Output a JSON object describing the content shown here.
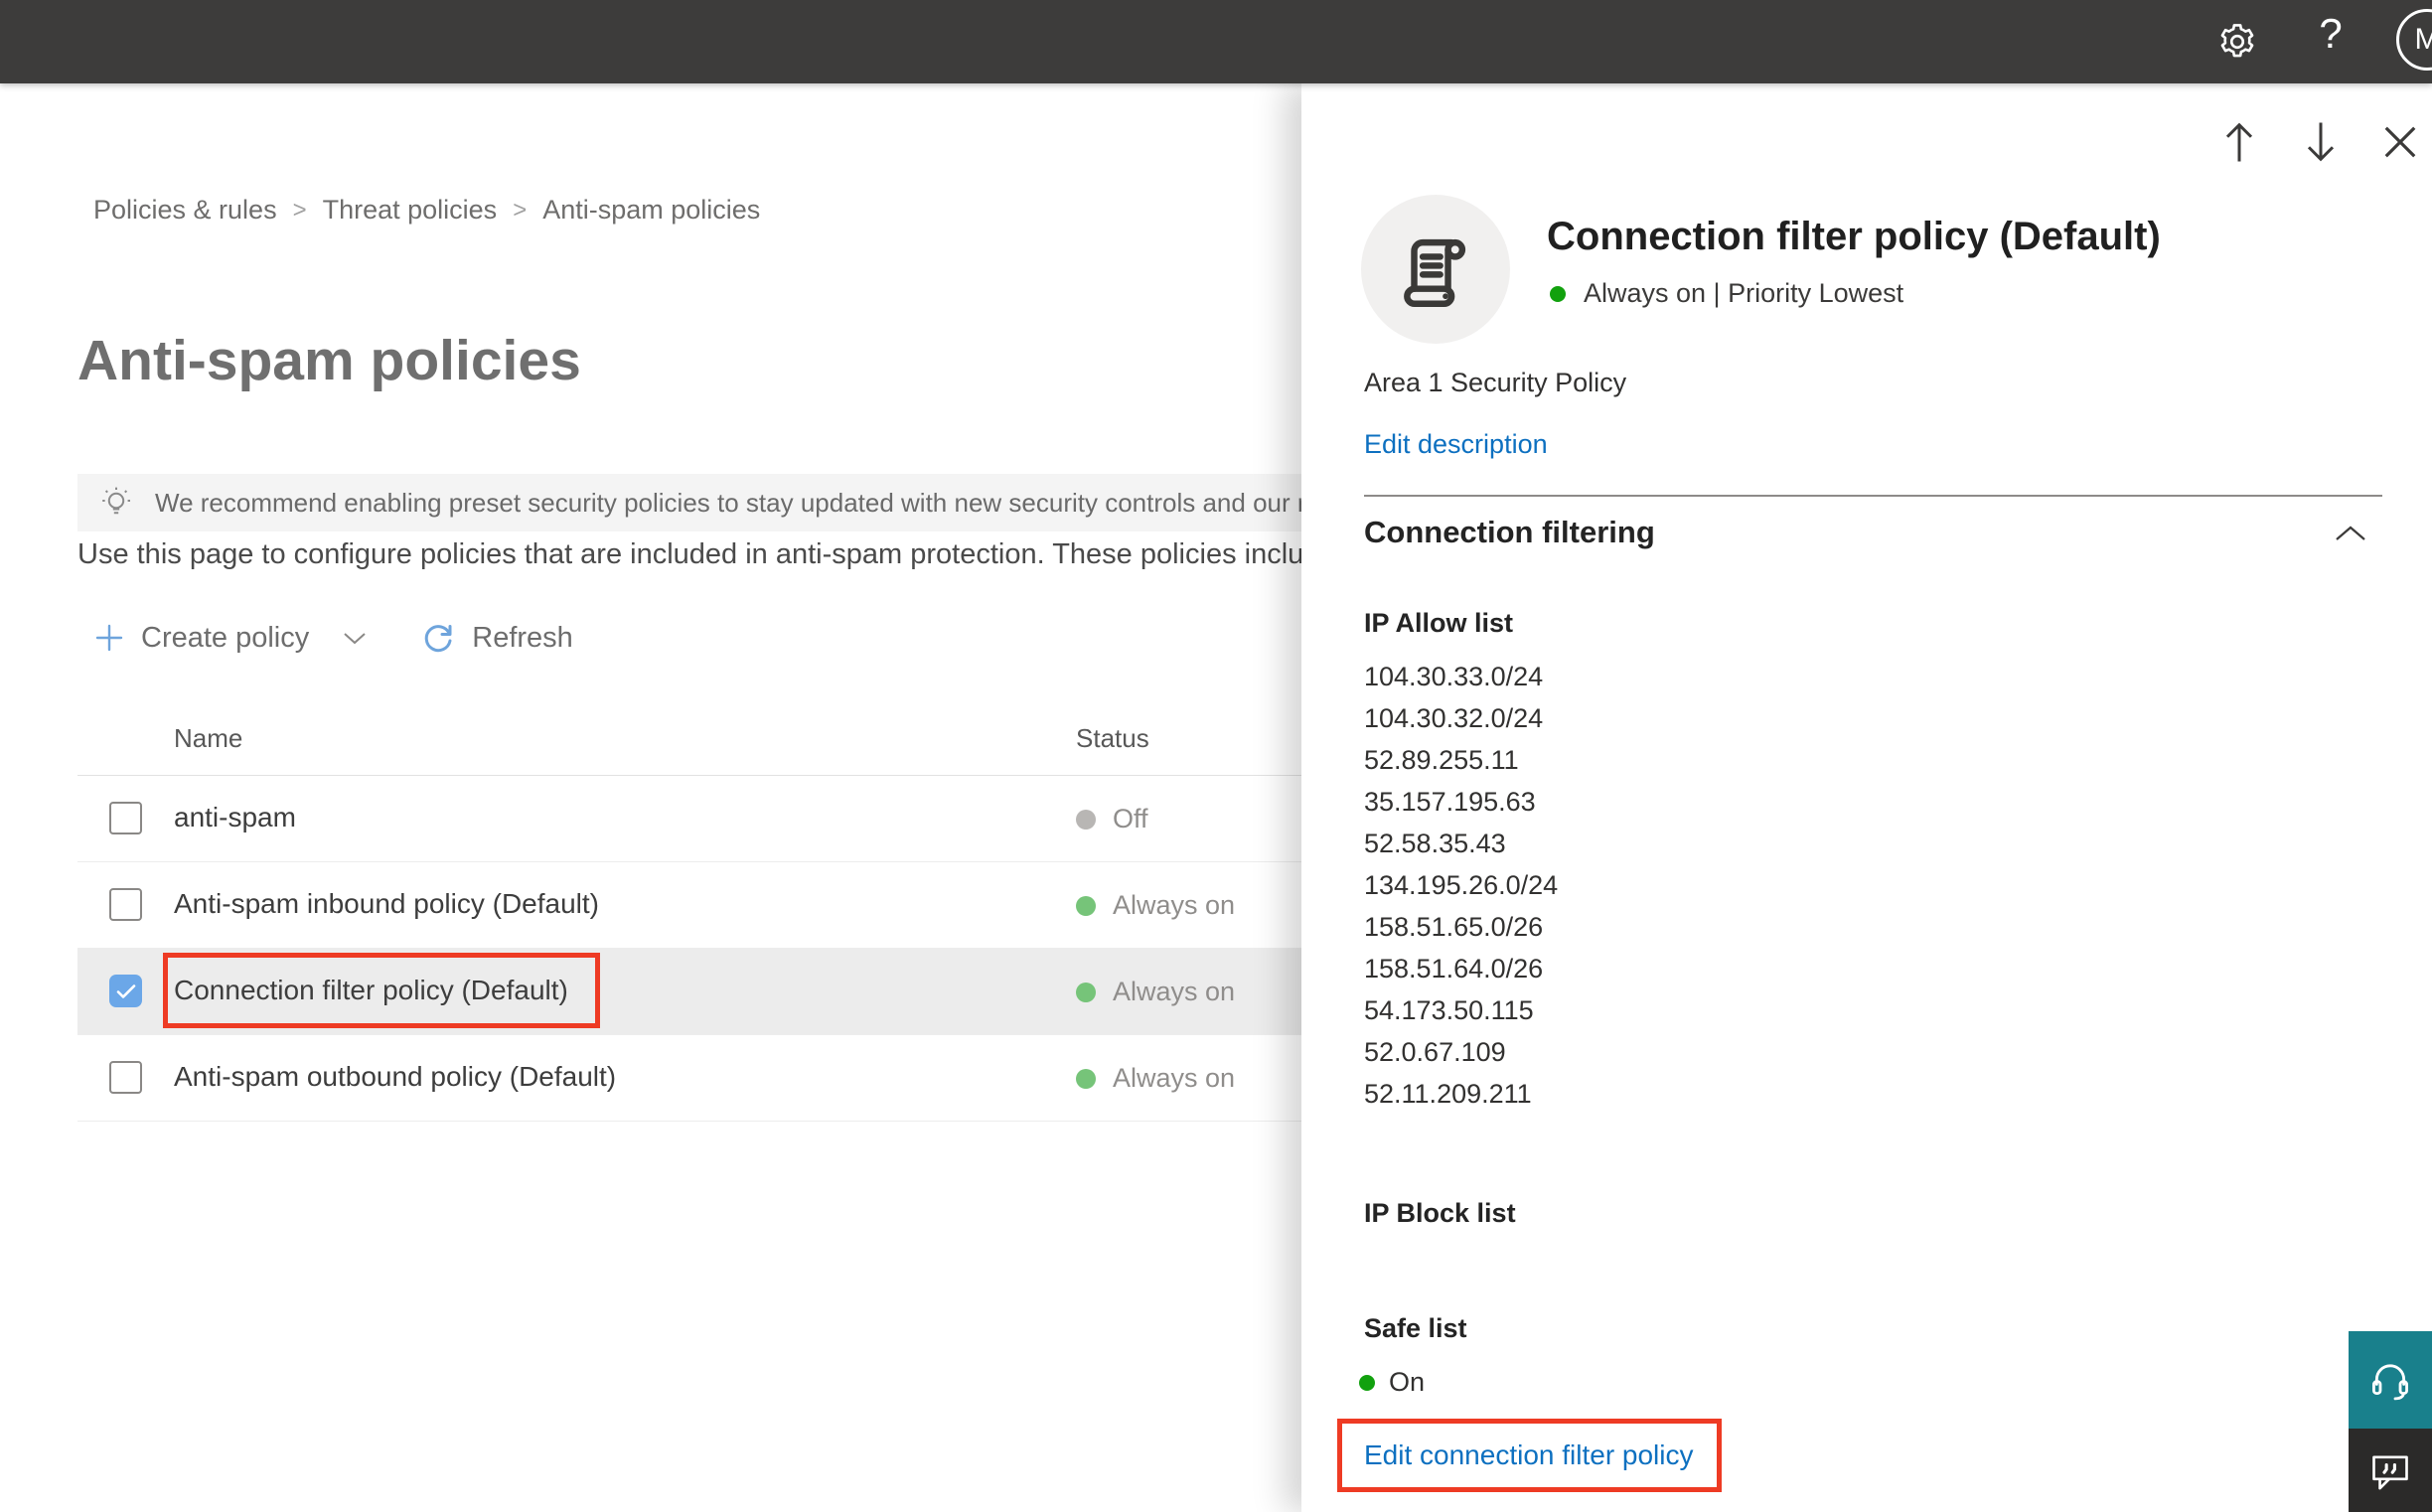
{
  "topbar": {
    "help_label": "?",
    "avatar_initial": "M"
  },
  "breadcrumb": {
    "items": [
      "Policies & rules",
      "Threat policies",
      "Anti-spam policies"
    ],
    "separator": ">"
  },
  "page": {
    "title": "Anti-spam policies",
    "banner_text": "We recommend enabling preset security policies to stay updated with new security controls and our recomme",
    "intro_text": "Use this page to configure policies that are included in anti-spam protection. These policies include"
  },
  "toolbar": {
    "create_policy_label": "Create policy",
    "refresh_label": "Refresh"
  },
  "table": {
    "columns": {
      "name": "Name",
      "status": "Status"
    },
    "rows": [
      {
        "name": "anti-spam",
        "status": "Off",
        "status_kind": "off",
        "checked": false,
        "selected": false,
        "annotated": false
      },
      {
        "name": "Anti-spam inbound policy (Default)",
        "status": "Always on",
        "status_kind": "on",
        "checked": false,
        "selected": false,
        "annotated": false
      },
      {
        "name": "Connection filter policy (Default)",
        "status": "Always on",
        "status_kind": "on",
        "checked": true,
        "selected": true,
        "annotated": true
      },
      {
        "name": "Anti-spam outbound policy (Default)",
        "status": "Always on",
        "status_kind": "on",
        "checked": false,
        "selected": false,
        "annotated": false
      }
    ]
  },
  "flyout": {
    "title": "Connection filter policy (Default)",
    "status_line": "Always on | Priority Lowest",
    "description": "Area 1 Security Policy",
    "edit_description_label": "Edit description",
    "section_title": "Connection filtering",
    "ip_allow_label": "IP Allow list",
    "ip_allow_items": [
      "104.30.33.0/24",
      "104.30.32.0/24",
      "52.89.255.11",
      "35.157.195.63",
      "52.58.35.43",
      "134.195.26.0/24",
      "158.51.65.0/26",
      "158.51.64.0/26",
      "54.173.50.115",
      "52.0.67.109",
      "52.11.209.211"
    ],
    "ip_block_label": "IP Block list",
    "safe_list_label": "Safe list",
    "safe_list_value": "On",
    "edit_link_label": "Edit connection filter policy"
  },
  "colors": {
    "topbar_bg": "#3d3c3b",
    "link_blue": "#0d70c0",
    "annotation_red": "#ee3b24",
    "green_bright": "#12a10e",
    "green_soft": "#76c479",
    "dot_gray": "#b8b6b4",
    "check_blue": "#6ba7e8",
    "selected_row": "#ececec",
    "banner_bg": "#f4f4f4",
    "teal": "#19808c",
    "dark_btn": "#2b2a29",
    "tool_icon_blue": "#6ea4dc"
  }
}
